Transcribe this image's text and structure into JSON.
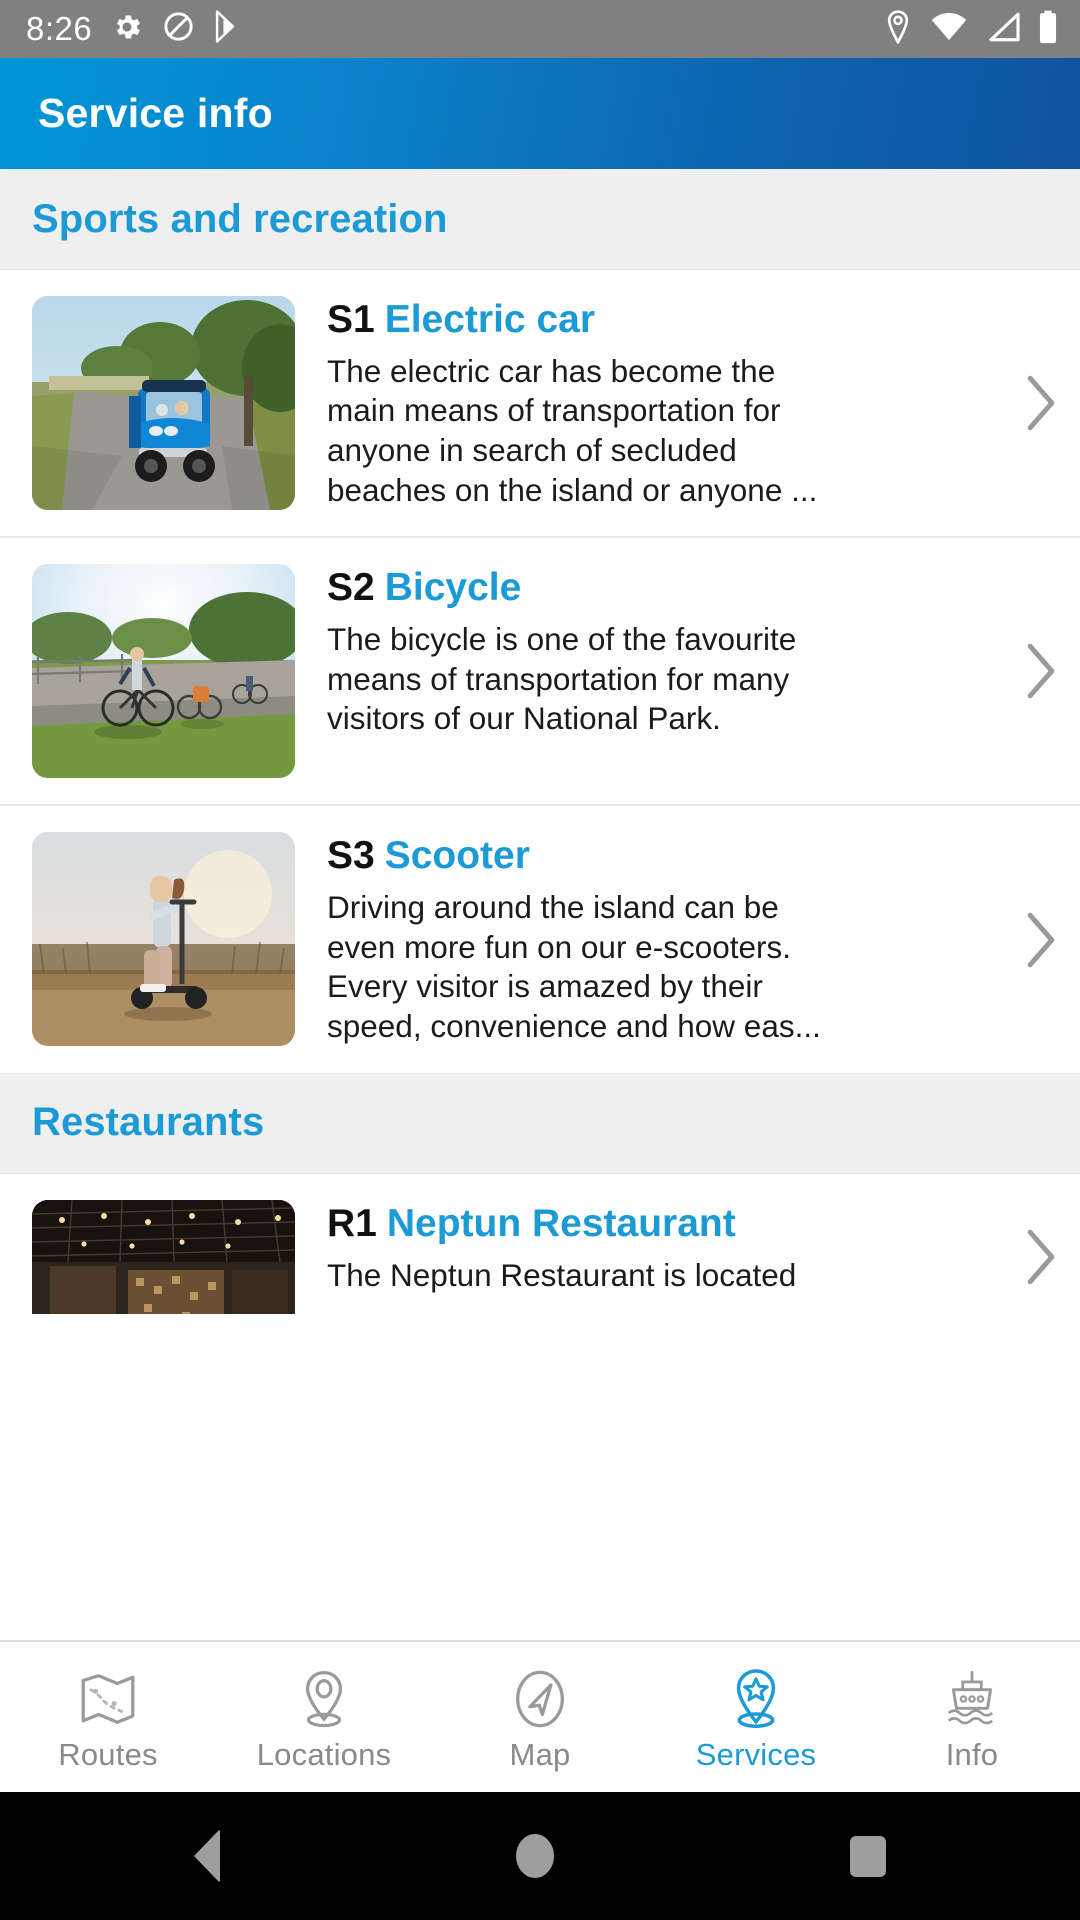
{
  "status_bar": {
    "time": "8:26",
    "left_icons": [
      "gear-icon",
      "do-not-disturb-icon",
      "play-store-icon"
    ],
    "right_icons": [
      "location-icon",
      "wifi-icon",
      "cellular-signal-icon",
      "battery-icon"
    ],
    "background_color": "#808080"
  },
  "app_bar": {
    "title": "Service info",
    "gradient_from": "#0096d6",
    "gradient_to": "#10539e",
    "title_color": "#ffffff"
  },
  "theme": {
    "accent_blue": "#1c9ad6",
    "section_band": "#efefef",
    "body_text": "#1b1b1b",
    "muted": "#8a8a8a"
  },
  "sections": [
    {
      "title": "Sports and recreation",
      "items": [
        {
          "code": "S1",
          "name": "Electric car",
          "description": "The electric car has become the main means of transportation for anyone in search of secluded beaches on the island or anyone ...",
          "thumb": "electric-car-photo",
          "chevron": "chevron-right-icon"
        },
        {
          "code": "S2",
          "name": "Bicycle",
          "description": "The bicycle is one of the favourite means of transportation for many visitors of our National Park.",
          "thumb": "bicycle-photo",
          "chevron": "chevron-right-icon"
        },
        {
          "code": "S3",
          "name": "Scooter",
          "description": "Driving around the island can be even more fun on our e-scooters. Every visitor is amazed by their speed, convenience and how eas...",
          "thumb": "scooter-photo",
          "chevron": "chevron-right-icon"
        }
      ]
    },
    {
      "title": "Restaurants",
      "items": [
        {
          "code": "R1",
          "name": "Neptun Restaurant",
          "description": "The Neptun Restaurant is located",
          "thumb": "restaurant-interior-photo",
          "chevron": "chevron-right-icon"
        }
      ]
    }
  ],
  "tab_bar": {
    "active_index": 3,
    "tabs": [
      {
        "label": "Routes",
        "icon": "folded-map-icon"
      },
      {
        "label": "Locations",
        "icon": "map-pin-icon"
      },
      {
        "label": "Map",
        "icon": "navigation-arrow-icon"
      },
      {
        "label": "Services",
        "icon": "star-pin-icon"
      },
      {
        "label": "Info",
        "icon": "ferry-ship-icon"
      }
    ]
  },
  "nav_bar": {
    "buttons": [
      {
        "name": "back-button"
      },
      {
        "name": "home-button"
      },
      {
        "name": "recents-button"
      }
    ]
  }
}
